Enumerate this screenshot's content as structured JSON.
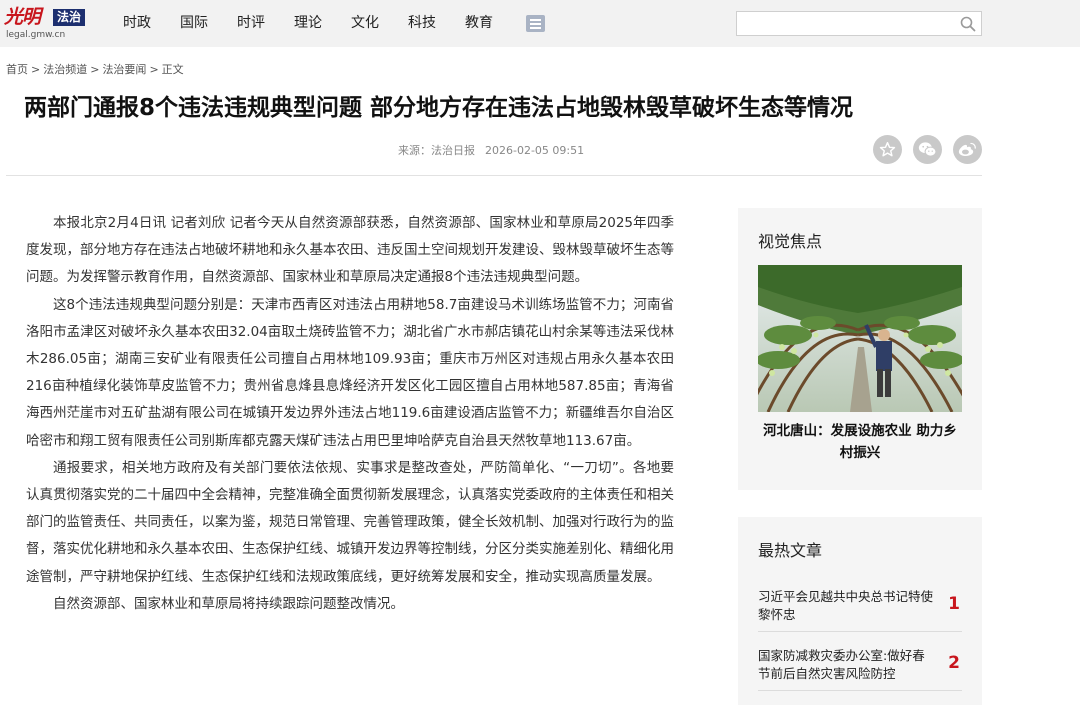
{
  "logo": {
    "main": "光明",
    "badge": "法治",
    "domain": "legal.gmw.cn"
  },
  "nav": [
    "时政",
    "国际",
    "时评",
    "理论",
    "文化",
    "科技",
    "教育"
  ],
  "search": {
    "placeholder": ""
  },
  "breadcrumb": [
    "首页",
    "法治频道",
    "法治要闻",
    "正文"
  ],
  "article": {
    "title": "两部门通报8个违法违规典型问题 部分地方存在违法占地毁林毁草破坏生态等情况",
    "source": "来源：法治日报",
    "date": "2026-02-05 09:51",
    "paragraphs": [
      "本报北京2月4日讯 记者刘欣 记者今天从自然资源部获悉，自然资源部、国家林业和草原局2025年四季度发现，部分地方存在违法占地破坏耕地和永久基本农田、违反国土空间规划开发建设、毁林毁草破坏生态等问题。为发挥警示教育作用，自然资源部、国家林业和草原局决定通报8个违法违规典型问题。",
      "这8个违法违规典型问题分别是：天津市西青区对违法占用耕地58.7亩建设马术训练场监管不力；河南省洛阳市孟津区对破坏永久基本农田32.04亩取土烧砖监管不力；湖北省广水市郝店镇花山村余某等违法采伐林木286.05亩；湖南三安矿业有限责任公司擅自占用林地109.93亩；重庆市万州区对违规占用永久基本农田216亩种植绿化装饰草皮监管不力；贵州省息烽县息烽经济开发区化工园区擅自占用林地587.85亩；青海省海西州茫崖市对五矿盐湖有限公司在城镇开发边界外违法占地119.6亩建设酒店监管不力；新疆维吾尔自治区哈密市和翔工贸有限责任公司别斯库都克露天煤矿违法占用巴里坤哈萨克自治县天然牧草地113.67亩。",
      "通报要求，相关地方政府及有关部门要依法依规、实事求是整改查处，严防简单化、“一刀切”。各地要认真贯彻落实党的二十届四中全会精神，完整准确全面贯彻新发展理念，认真落实党委政府的主体责任和相关部门的监管责任、共同责任，以案为鉴，规范日常管理、完善管理政策，健全长效机制、加强对行政行为的监督，落实优化耕地和永久基本农田、生态保护红线、城镇开发边界等控制线，分区分类实施差别化、精细化用途管制，严守耕地保护红线、生态保护红线和法规政策底线，更好统筹发展和安全，推动实现高质量发展。",
      "自然资源部、国家林业和草原局将持续跟踪问题整改情况。"
    ]
  },
  "sidebar": {
    "visual": {
      "title": "视觉焦点",
      "caption": "河北唐山：发展设施农业 助力乡村振兴"
    },
    "hot": {
      "title": "最热文章",
      "items": [
        {
          "text": "习近平会见越共中央总书记特使黎怀忠",
          "rank": "1"
        },
        {
          "text": "国家防减救灾委办公室:做好春节前后自然灾害风险防控",
          "rank": "2"
        }
      ]
    }
  },
  "colors": {
    "brand_red": "#c8161d",
    "logo_blue": "#1d2f6f",
    "nav_bg": "#f2f2f2",
    "panel_bg": "#f5f5f5",
    "share_gray": "#c9c9c9"
  },
  "icons": {
    "search": "search-icon",
    "menu": "menu-icon",
    "favorite": "star-icon",
    "wechat": "wechat-icon",
    "weibo": "weibo-icon"
  }
}
